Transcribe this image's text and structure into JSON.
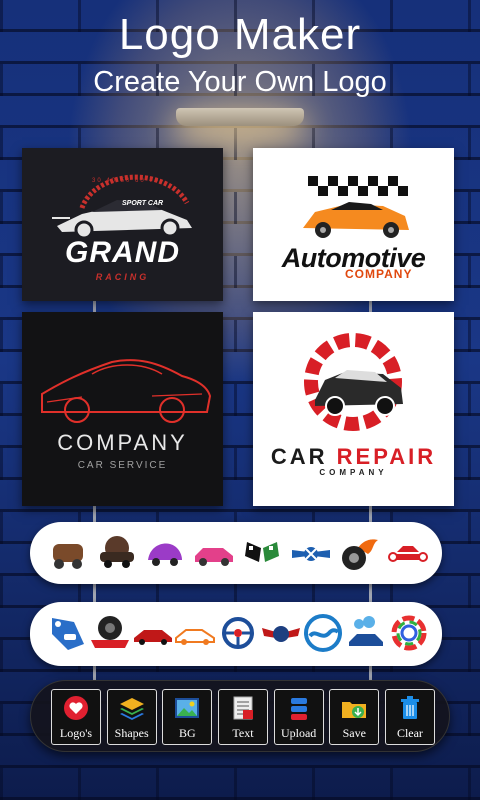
{
  "header": {
    "title": "Logo Maker",
    "subtitle": "Create Your Own Logo"
  },
  "featured_logos": [
    {
      "name": "grand-racing",
      "badge": "SPORT CAR",
      "gauge_numbers": "30 40 50 60 70",
      "main_text": "GRAND",
      "sub_text": "RACING"
    },
    {
      "name": "automotive-company",
      "main_text": "Automotive",
      "sub_text": "COMPANY"
    },
    {
      "name": "company-car-service",
      "main_text": "COMPANY",
      "sub_text": "CAR SERVICE"
    },
    {
      "name": "car-repair-company",
      "main_text_part1": "CAR",
      "main_text_part2": "REPAIR",
      "sub_text": "COMPANY"
    }
  ],
  "category_strip_1": [
    "vintage-car-logo",
    "classic-car-logo",
    "beetle-car-logo",
    "pink-car-logo",
    "checkered-flag-logo",
    "winged-wrench-logo",
    "flaming-wheel-logo",
    "wrench-car-logo"
  ],
  "category_strip_2": [
    "tag-car-logo",
    "tire-ribbon-logo",
    "red-sports-car-logo",
    "orange-car-logo",
    "steering-wheel-logo",
    "winged-badge-logo",
    "wave-circle-logo",
    "blue-car-wash-logo",
    "rainbow-ring-logo"
  ],
  "toolbar": {
    "logos": "Logo's",
    "shapes": "Shapes",
    "bg": "BG",
    "text": "Text",
    "upload": "Upload",
    "save": "Save",
    "clear": "Clear"
  },
  "colors": {
    "background": "#1a3786",
    "accent_red": "#d81f26",
    "accent_orange": "#e0480e",
    "toolbar_bg": "#14141c"
  }
}
